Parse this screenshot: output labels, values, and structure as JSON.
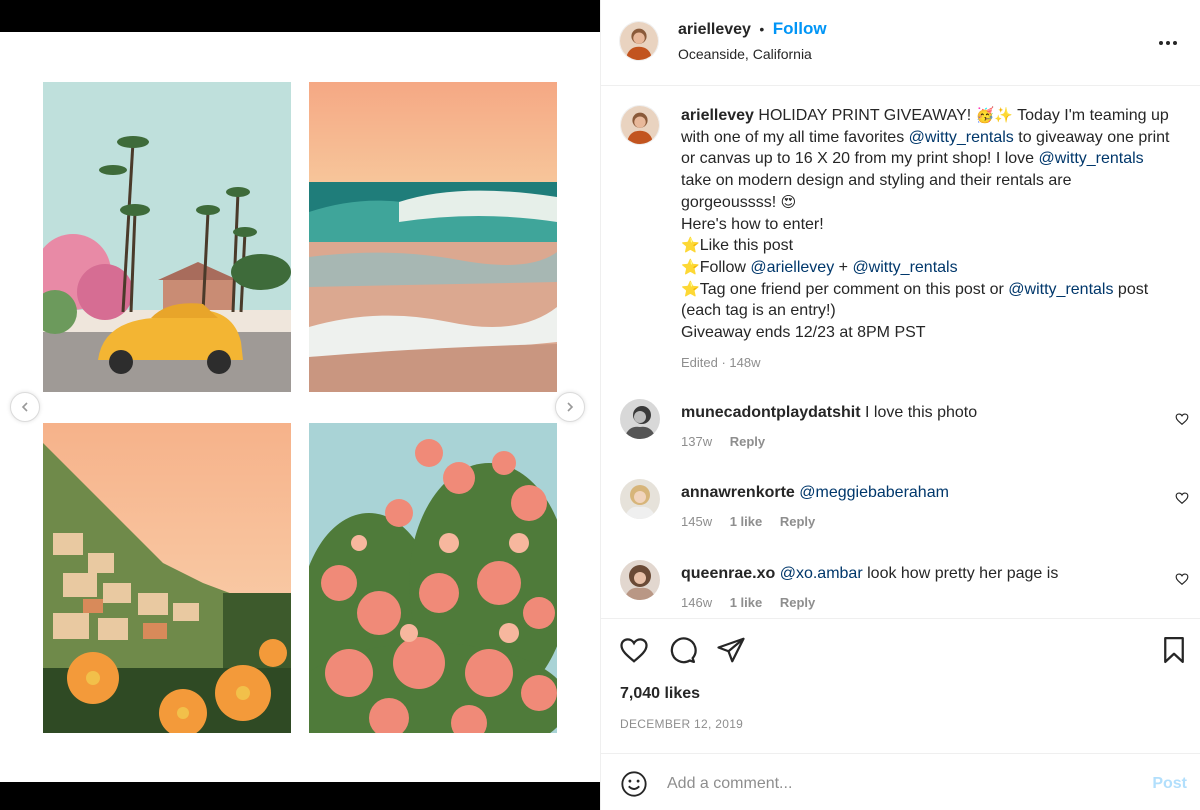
{
  "post": {
    "username": "ariellevey",
    "separator": "•",
    "follow_label": "Follow",
    "location": "Oceanside, California",
    "more_icon": "more-options-icon"
  },
  "caption": {
    "username": "ariellevey",
    "line1_text": "HOLIDAY PRINT GIVEAWAY! ",
    "line1_emojis": "🥳✨",
    "line1_rest": " Today I'm teaming up with one of my all time favorites ",
    "mention1": "@witty_rentals",
    "line2": " to giveaway one print or canvas up to 16 X 20 from my print shop! I love ",
    "mention2": "@witty_rentals",
    "line3": " take on modern design and styling and their rentals are gorgeoussss! ",
    "emoji_heart_eyes": "😍",
    "how_to": "Here's how to enter!",
    "star": "⭐",
    "step1": "Like this post",
    "step2_prefix": "Follow ",
    "step2_mention_a": "@ariellevey",
    "step2_plus": " + ",
    "step2_mention_b": "@witty_rentals",
    "step3_prefix": "Tag one friend per comment on this post or ",
    "step3_mention": "@witty_rentals",
    "step3_suffix": " post (each tag is an entry!)",
    "ends": "Giveaway ends 12/23 at 8PM PST",
    "meta": "Edited · 148w"
  },
  "comments": [
    {
      "username": "munecadontplaydatshit",
      "mention": "",
      "text": "I love this photo",
      "age": "137w",
      "likes": "",
      "reply": "Reply"
    },
    {
      "username": "annawrenkorte",
      "mention": "@meggiebaberaham",
      "text": "",
      "age": "145w",
      "likes": "1 like",
      "reply": "Reply"
    },
    {
      "username": "queenrae.xo",
      "mention": "@xo.ambar",
      "text": "look how pretty her page is",
      "age": "146w",
      "likes": "1 like",
      "reply": "Reply"
    }
  ],
  "actions": {
    "like_icon": "heart-icon",
    "comment_icon": "comment-icon",
    "share_icon": "share-icon",
    "save_icon": "bookmark-icon",
    "likes": "7,040 likes",
    "date": "DECEMBER 12, 2019"
  },
  "add_comment": {
    "placeholder": "Add a comment...",
    "post_label": "Post",
    "emoji_icon": "emoji-icon"
  },
  "colors": {
    "link_blue": "#0095f6",
    "mention_blue": "#00376b",
    "muted": "#8e8e8e",
    "post_disabled": "#b2dffc"
  }
}
